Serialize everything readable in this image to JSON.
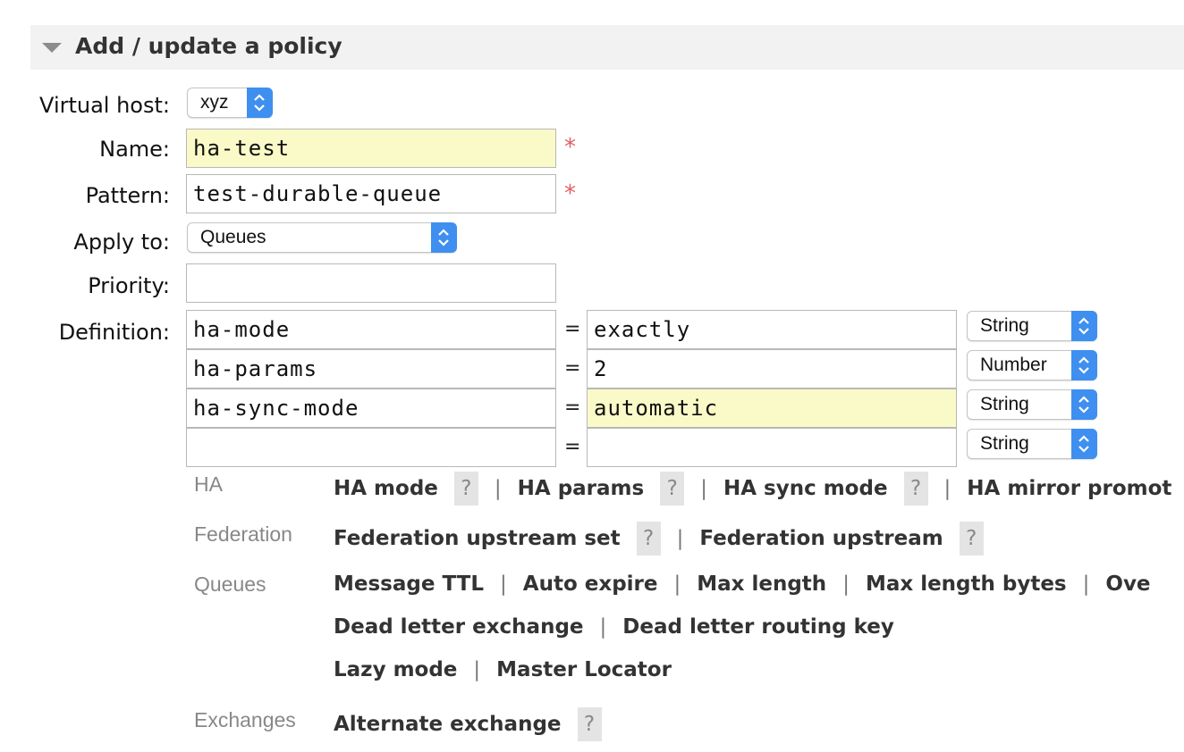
{
  "section": {
    "title": "Add / update a policy"
  },
  "form": {
    "vhost_label": "Virtual host:",
    "vhost_value": "xyz",
    "name_label": "Name:",
    "name_value": "ha-test",
    "pattern_label": "Pattern:",
    "pattern_value": "test-durable-queue",
    "apply_label": "Apply to:",
    "apply_value": "Queues",
    "priority_label": "Priority:",
    "priority_value": "",
    "definition_label": "Definition:",
    "required_mark": "*"
  },
  "definition": [
    {
      "key": "ha-mode",
      "eq": "=",
      "value": "exactly",
      "type": "String"
    },
    {
      "key": "ha-params",
      "eq": "=",
      "value": "2",
      "type": "Number"
    },
    {
      "key": "ha-sync-mode",
      "eq": "=",
      "value": "automatic",
      "type": "String"
    },
    {
      "key": "",
      "eq": "=",
      "value": "",
      "type": "String"
    }
  ],
  "help": {
    "ha": {
      "category": "HA",
      "items": [
        "HA mode",
        "HA params",
        "HA sync mode",
        "HA mirror promot"
      ]
    },
    "federation": {
      "category": "Federation",
      "items": [
        "Federation upstream set",
        "Federation upstream"
      ]
    },
    "queues": {
      "category": "Queues",
      "items": [
        "Message TTL",
        "Auto expire",
        "Max length",
        "Max length bytes",
        "Ove",
        "Dead letter exchange",
        "Dead letter routing key",
        "Lazy mode",
        "Master Locator"
      ]
    },
    "exchanges": {
      "category": "Exchanges",
      "items": [
        "Alternate exchange"
      ]
    },
    "separator": "|",
    "help_mark": "?"
  }
}
